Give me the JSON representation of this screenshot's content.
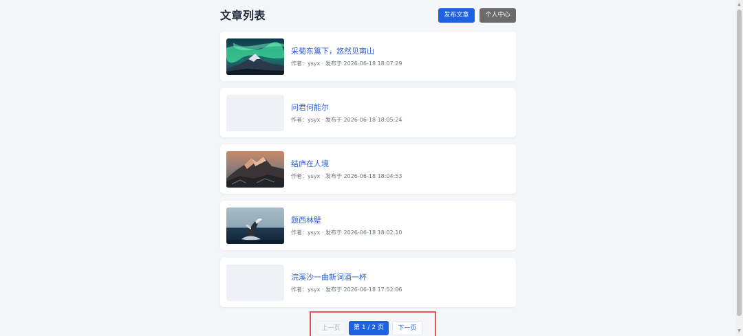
{
  "header": {
    "title": "文章列表",
    "publish_label": "发布文章",
    "profile_label": "个人中心"
  },
  "articles": [
    {
      "title": "采菊东篱下，悠然见南山",
      "meta": "作者：ysyx · 发布于 2026-06-18 18:07:29",
      "thumbnail": "aurora-mountain-image"
    },
    {
      "title": "问君何能尔",
      "meta": "作者：ysyx · 发布于 2026-06-18 18:05:24",
      "thumbnail": "empty-placeholder"
    },
    {
      "title": "结庐在人境",
      "meta": "作者：ysyx · 发布于 2026-06-18 18:04:53",
      "thumbnail": "rocky-mountain-image"
    },
    {
      "title": "题西林壁",
      "meta": "作者：ysyx · 发布于 2026-06-18 18:02:10",
      "thumbnail": "whale-breach-image"
    },
    {
      "title": "浣溪沙一曲新词酒一杯",
      "meta": "作者：ysyx · 发布于 2026-06-18 17:52:06",
      "thumbnail": "empty-placeholder"
    }
  ],
  "pagination": {
    "prev_label": "上一页",
    "current_label": "第 1 / 2 页",
    "next_label": "下一页"
  },
  "colors": {
    "accent": "#1f62e0",
    "link": "#2c5fd6",
    "secondary_button": "#6b6b6b",
    "highlight_border": "#e35a5a",
    "background": "#f4f6fa"
  }
}
